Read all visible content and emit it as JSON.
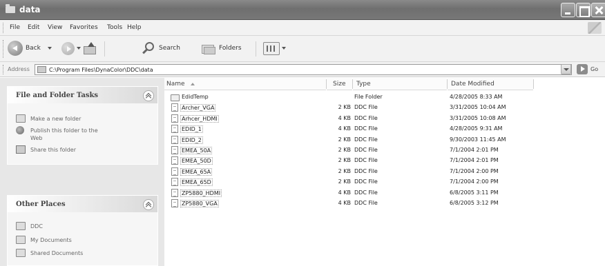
{
  "window": {
    "title": "data"
  },
  "menu": [
    "File",
    "Edit",
    "View",
    "Favorites",
    "Tools",
    "Help"
  ],
  "toolbar": {
    "back_label": "Back",
    "search_label": "Search",
    "folders_label": "Folders"
  },
  "address": {
    "label": "Address",
    "value": "C:\\Program Files\\DynaColor\\DDC\\data",
    "go_label": "Go"
  },
  "tasks_panel": {
    "title": "File and Folder Tasks",
    "items": [
      {
        "label": "Make a new folder",
        "icon": "new-folder-icon"
      },
      {
        "label": "Publish this folder to the Web",
        "icon": "globe-icon"
      },
      {
        "label": "Share this folder",
        "icon": "share-folder-icon"
      }
    ]
  },
  "places_panel": {
    "title": "Other Places",
    "items": [
      {
        "label": "DDC",
        "icon": "folder-icon"
      },
      {
        "label": "My Documents",
        "icon": "my-documents-icon"
      },
      {
        "label": "Shared Documents",
        "icon": "shared-documents-icon"
      }
    ]
  },
  "columns": {
    "name": "Name",
    "size": "Size",
    "type": "Type",
    "date": "Date Modified"
  },
  "files": [
    {
      "name": "EdidTemp",
      "size": "",
      "type": "File Folder",
      "date": "4/28/2005 8:33 AM",
      "kind": "folder"
    },
    {
      "name": "Archer_VGA",
      "size": "2 KB",
      "type": "DDC File",
      "date": "3/31/2005 10:04 AM",
      "kind": "file"
    },
    {
      "name": "Arhcer_HDMI",
      "size": "4 KB",
      "type": "DDC File",
      "date": "3/31/2005 10:08 AM",
      "kind": "file"
    },
    {
      "name": "EDID_1",
      "size": "4 KB",
      "type": "DDC File",
      "date": "4/28/2005 9:31 AM",
      "kind": "file"
    },
    {
      "name": "EDID_2",
      "size": "2 KB",
      "type": "DDC File",
      "date": "9/30/2003 11:45 AM",
      "kind": "file"
    },
    {
      "name": "EMEA_50A",
      "size": "2 KB",
      "type": "DDC File",
      "date": "7/1/2004 2:01 PM",
      "kind": "file"
    },
    {
      "name": "EMEA_50D",
      "size": "2 KB",
      "type": "DDC File",
      "date": "7/1/2004 2:01 PM",
      "kind": "file"
    },
    {
      "name": "EMEA_65A",
      "size": "2 KB",
      "type": "DDC File",
      "date": "7/1/2004 2:00 PM",
      "kind": "file"
    },
    {
      "name": "EMEA_65D",
      "size": "2 KB",
      "type": "DDC File",
      "date": "7/1/2004 2:00 PM",
      "kind": "file"
    },
    {
      "name": "ZP5880_HDMI",
      "size": "4 KB",
      "type": "DDC File",
      "date": "6/8/2005 3:11 PM",
      "kind": "file"
    },
    {
      "name": "ZP5880_VGA",
      "size": "4 KB",
      "type": "DDC File",
      "date": "6/8/2005 3:12 PM",
      "kind": "file"
    }
  ]
}
